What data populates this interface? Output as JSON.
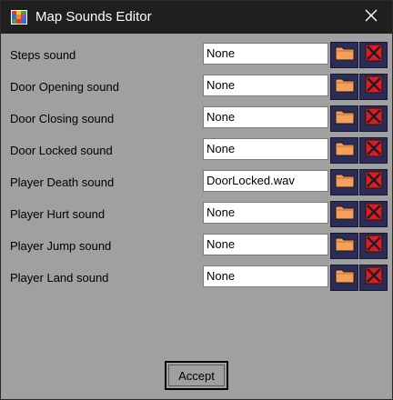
{
  "window": {
    "title": "Map Sounds Editor",
    "app_icon": "color-grid-icon",
    "close_icon": "close-icon"
  },
  "rows": [
    {
      "label": "Steps sound",
      "value": "None"
    },
    {
      "label": "Door Opening sound",
      "value": "None"
    },
    {
      "label": "Door Closing sound",
      "value": "None"
    },
    {
      "label": "Door Locked sound",
      "value": "None"
    },
    {
      "label": "Player Death sound",
      "value": "DoorLocked.wav"
    },
    {
      "label": "Player Hurt sound",
      "value": "None"
    },
    {
      "label": "Player Jump sound",
      "value": "None"
    },
    {
      "label": "Player Land sound",
      "value": "None"
    }
  ],
  "row_buttons": {
    "browse_icon": "folder-icon",
    "clear_icon": "red-x-icon"
  },
  "footer": {
    "accept_label": "Accept"
  },
  "colors": {
    "background": "#a0a0a0",
    "titlebar": "#1f1f1f",
    "button_navy": "#2c2c58",
    "folder_orange": "#f5a05a",
    "clear_red": "#e01c1c"
  }
}
